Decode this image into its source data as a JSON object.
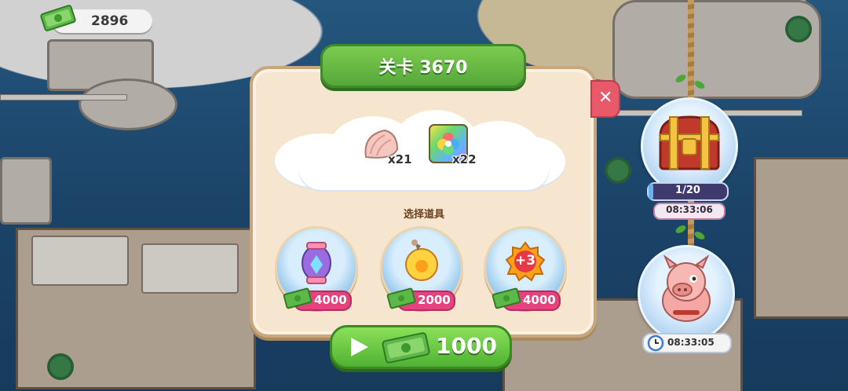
{
  "hud": {
    "cash_amount": "2896",
    "cash_icon": "cash-bundle-icon"
  },
  "popup": {
    "title": "关卡 3670",
    "close_icon": "close-icon",
    "rewards": [
      {
        "icon": "seashell-icon",
        "qty": "x21"
      },
      {
        "icon": "rainbow-flower-box-icon",
        "qty": "x22"
      }
    ],
    "boosters_label": "选择道具",
    "boosters": [
      {
        "icon": "lantern-booster-icon",
        "price": "4000"
      },
      {
        "icon": "bomb-orb-booster-icon",
        "price": "2000"
      },
      {
        "icon": "plus-three-moves-icon",
        "badge": "+3",
        "price": "4000"
      }
    ],
    "play": {
      "icon": "play-icon",
      "cost": "1000"
    }
  },
  "events": {
    "chest": {
      "icon": "treasure-chest-icon",
      "progress_text": "1/20",
      "progress": 0.05,
      "timer": "08:33:06"
    },
    "piggy": {
      "icon": "piggy-bank-icon",
      "timer_icon": "clock-icon",
      "timer": "08:33:05"
    }
  },
  "colors": {
    "accent_green": "#55a83a",
    "price_pink": "#e6427d",
    "panel_cream": "#f6e6cf"
  }
}
